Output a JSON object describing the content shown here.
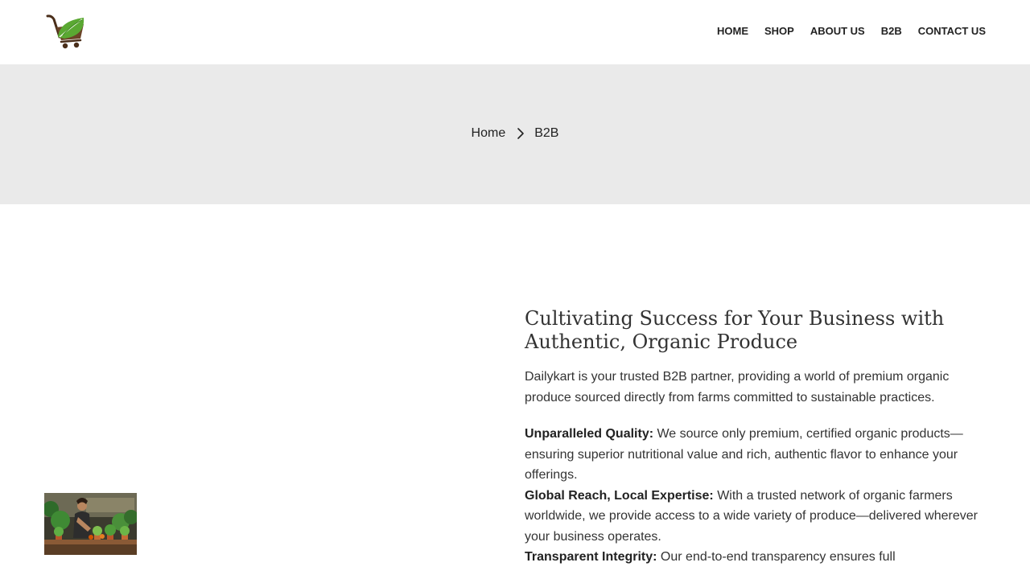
{
  "header": {
    "logo_alt": "Dailykart logo",
    "nav": [
      {
        "label": "HOME"
      },
      {
        "label": "SHOP"
      },
      {
        "label": "ABOUT US"
      },
      {
        "label": "B2B"
      },
      {
        "label": "CONTACT US"
      }
    ]
  },
  "breadcrumb": {
    "home": "Home",
    "current": "B2B"
  },
  "main": {
    "headline": "Cultivating Success for Your Business with Authentic, Organic Produce",
    "intro": "Dailykart is your trusted B2B partner, providing a world of premium organic produce sourced directly from farms committed to sustainable practices.",
    "features": [
      {
        "title": "Unparalleled Quality:",
        "text": " We source only premium, certified organic products—ensuring superior nutritional value and rich, authentic flavor to enhance your offerings."
      },
      {
        "title": "Global Reach, Local Expertise:",
        "text": " With a trusted network of organic farmers worldwide, we provide access to a wide variety of produce—delivered wherever your business operates."
      },
      {
        "title": "Transparent Integrity:",
        "text": " Our end-to-end transparency ensures full"
      }
    ]
  },
  "colors": {
    "banner_bg": "#eaeaea",
    "leaf_green": "#5aa832",
    "cart_brown": "#5a3a22"
  }
}
